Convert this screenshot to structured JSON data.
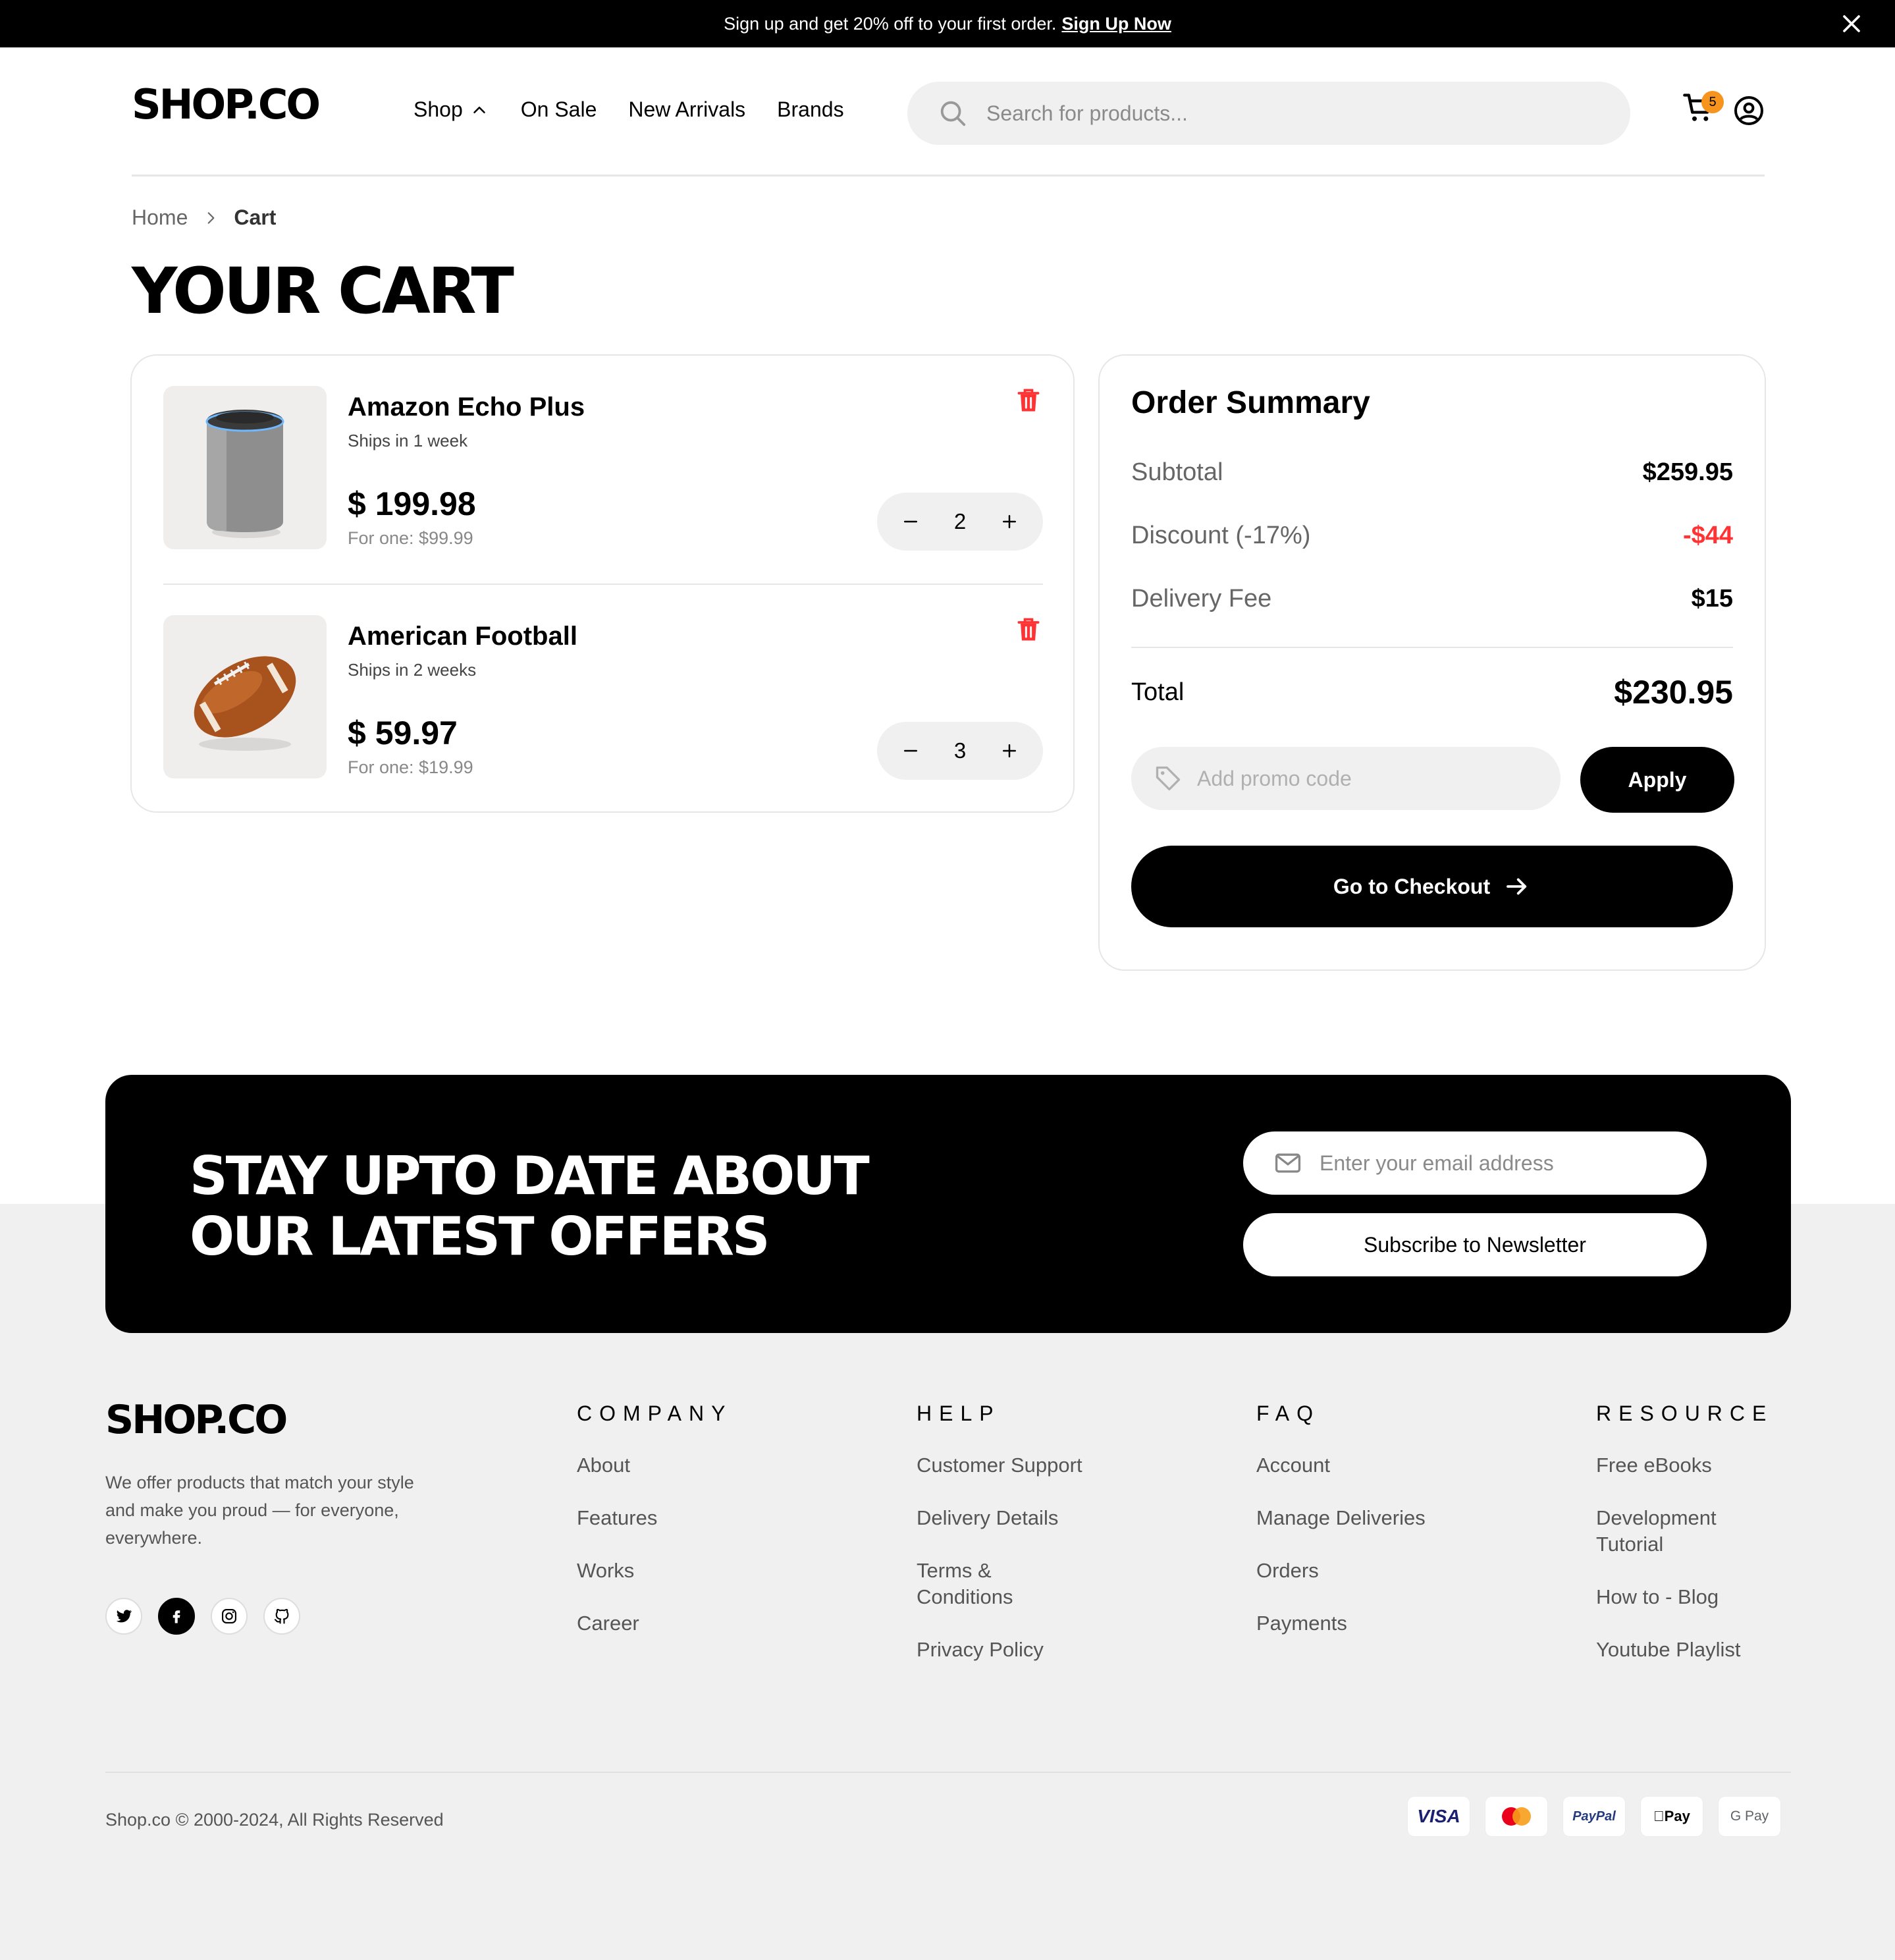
{
  "banner": {
    "text": "Sign up and get 20% off to your first order.",
    "link": "Sign Up Now"
  },
  "header": {
    "logo": "SHOP.CO",
    "nav": [
      "Shop",
      "On Sale",
      "New Arrivals",
      "Brands"
    ],
    "search_placeholder": "Search for products...",
    "cart_count": "5"
  },
  "breadcrumb": {
    "home": "Home",
    "current": "Cart"
  },
  "page_title": "YOUR CART",
  "cart": {
    "items": [
      {
        "name": "Amazon Echo Plus",
        "shipping": "Ships in 1 week",
        "price": "$ 199.98",
        "unit_price": "For one: $99.99",
        "quantity": "2"
      },
      {
        "name": "American Football",
        "shipping": "Ships in 2 weeks",
        "price": "$ 59.97",
        "unit_price": "For one: $19.99",
        "quantity": "3"
      }
    ]
  },
  "summary": {
    "title": "Order Summary",
    "subtotal_label": "Subtotal",
    "subtotal": "$259.95",
    "discount_label": "Discount (-17%)",
    "discount": "-$44",
    "delivery_label": "Delivery Fee",
    "delivery": "$15",
    "total_label": "Total",
    "total": "$230.95",
    "promo_placeholder": "Add promo code",
    "apply_label": "Apply",
    "checkout_label": "Go to Checkout"
  },
  "newsletter": {
    "title_line1": "STAY UPTO DATE ABOUT",
    "title_line2": "OUR LATEST OFFERS",
    "email_placeholder": "Enter your email address",
    "button": "Subscribe to Newsletter"
  },
  "footer": {
    "logo": "SHOP.CO",
    "description": "We offer products that match your style and make you proud — for everyone, everywhere.",
    "columns": [
      {
        "title": "COMPANY",
        "links": [
          "About",
          "Features",
          "Works",
          "Career"
        ]
      },
      {
        "title": "HELP",
        "links": [
          "Customer Support",
          "Delivery Details",
          "Terms & Conditions",
          "Privacy Policy"
        ]
      },
      {
        "title": "FAQ",
        "links": [
          "Account",
          "Manage Deliveries",
          "Orders",
          "Payments"
        ]
      },
      {
        "title": "RESOURCE",
        "links": [
          "Free eBooks",
          "Development Tutorial",
          "How to - Blog",
          "Youtube Playlist"
        ]
      }
    ],
    "copyright": "Shop.co © 2000-2024, All Rights Reserved",
    "payments": [
      "VISA",
      "PayPal",
      "Pay",
      "G Pay"
    ]
  },
  "colors": {
    "accent": "#000000",
    "discount": "#ff3333",
    "trash": "#ff3333",
    "badge": "#f7941d",
    "footer_bg": "#f0f0f0"
  }
}
